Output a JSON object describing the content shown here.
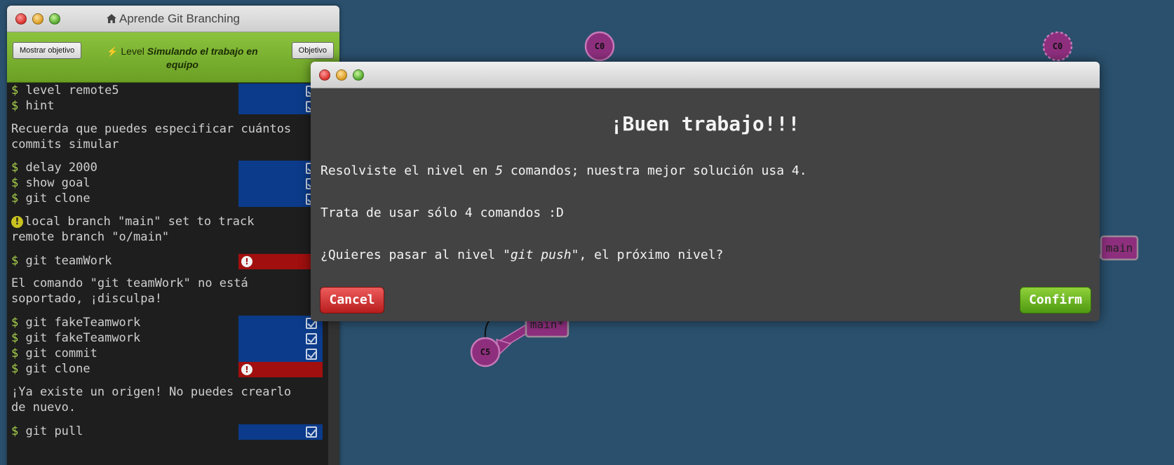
{
  "terminal": {
    "title": "Aprende Git Branching",
    "show_goal_label": "Mostrar objetivo",
    "objective_label": "Objetivo",
    "level_prefix": "Level",
    "level_name": "Simulando el trabajo en equipo",
    "prompt": "$",
    "lines": {
      "l1": "level remote5",
      "l2": "hint",
      "l3a": "Recuerda que puedes especificar cuántos",
      "l3b": "commits simular",
      "l4": "delay 2000",
      "l5": "show goal",
      "l6": "git clone",
      "l7a": "local branch \"main\" set to track",
      "l7b": "remote branch \"o/main\"",
      "l8": "git teamWork",
      "l9a": "El comando \"git teamWork\" no está",
      "l9b": "soportado, ¡disculpa!",
      "l10": "git fakeTeamwork",
      "l11": "git fakeTeamwork",
      "l12": "git commit",
      "l13": "git clone",
      "l14a": "¡Ya existe un origen! No puedes crearlo",
      "l14b": "de nuevo.",
      "l15": "git pull"
    }
  },
  "visualization": {
    "nodes": {
      "c0_left": "C0",
      "c0_right": "C0",
      "c5": "C5"
    },
    "branches": {
      "main_right": "main",
      "main_star": "main*"
    },
    "colors": {
      "background": "#2a506d",
      "node_fill": "#8e2f7e",
      "node_stroke": "#c779b8"
    }
  },
  "modal": {
    "title": "¡Buen trabajo!!!",
    "p1_before": "Resolviste el nivel en ",
    "p1_count": "5",
    "p1_after": " comandos; nuestra mejor solución usa 4.",
    "p2": "Trata de usar sólo 4 comandos :D",
    "p3_before": "¿Quieres pasar al nivel ",
    "p3_level": "\"git push\"",
    "p3_after": ", el próximo nivel?",
    "cancel_label": "Cancel",
    "confirm_label": "Confirm"
  }
}
